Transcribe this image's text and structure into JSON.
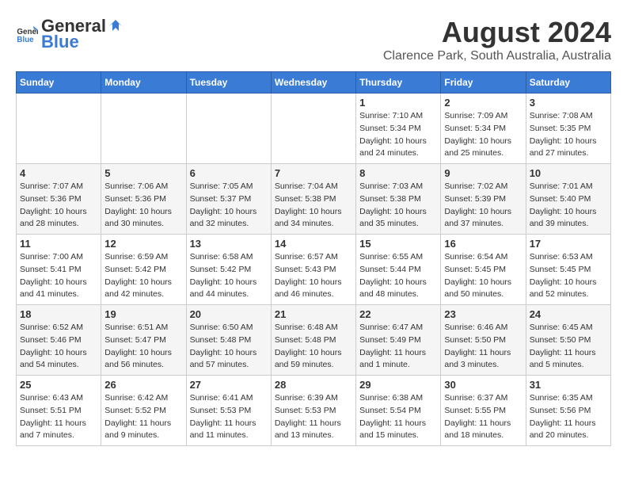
{
  "header": {
    "logo_general": "General",
    "logo_blue": "Blue",
    "main_title": "August 2024",
    "subtitle": "Clarence Park, South Australia, Australia"
  },
  "calendar": {
    "days_of_week": [
      "Sunday",
      "Monday",
      "Tuesday",
      "Wednesday",
      "Thursday",
      "Friday",
      "Saturday"
    ],
    "weeks": [
      [
        {
          "day": "",
          "info": ""
        },
        {
          "day": "",
          "info": ""
        },
        {
          "day": "",
          "info": ""
        },
        {
          "day": "",
          "info": ""
        },
        {
          "day": "1",
          "info": "Sunrise: 7:10 AM\nSunset: 5:34 PM\nDaylight: 10 hours\nand 24 minutes."
        },
        {
          "day": "2",
          "info": "Sunrise: 7:09 AM\nSunset: 5:34 PM\nDaylight: 10 hours\nand 25 minutes."
        },
        {
          "day": "3",
          "info": "Sunrise: 7:08 AM\nSunset: 5:35 PM\nDaylight: 10 hours\nand 27 minutes."
        }
      ],
      [
        {
          "day": "4",
          "info": "Sunrise: 7:07 AM\nSunset: 5:36 PM\nDaylight: 10 hours\nand 28 minutes."
        },
        {
          "day": "5",
          "info": "Sunrise: 7:06 AM\nSunset: 5:36 PM\nDaylight: 10 hours\nand 30 minutes."
        },
        {
          "day": "6",
          "info": "Sunrise: 7:05 AM\nSunset: 5:37 PM\nDaylight: 10 hours\nand 32 minutes."
        },
        {
          "day": "7",
          "info": "Sunrise: 7:04 AM\nSunset: 5:38 PM\nDaylight: 10 hours\nand 34 minutes."
        },
        {
          "day": "8",
          "info": "Sunrise: 7:03 AM\nSunset: 5:38 PM\nDaylight: 10 hours\nand 35 minutes."
        },
        {
          "day": "9",
          "info": "Sunrise: 7:02 AM\nSunset: 5:39 PM\nDaylight: 10 hours\nand 37 minutes."
        },
        {
          "day": "10",
          "info": "Sunrise: 7:01 AM\nSunset: 5:40 PM\nDaylight: 10 hours\nand 39 minutes."
        }
      ],
      [
        {
          "day": "11",
          "info": "Sunrise: 7:00 AM\nSunset: 5:41 PM\nDaylight: 10 hours\nand 41 minutes."
        },
        {
          "day": "12",
          "info": "Sunrise: 6:59 AM\nSunset: 5:42 PM\nDaylight: 10 hours\nand 42 minutes."
        },
        {
          "day": "13",
          "info": "Sunrise: 6:58 AM\nSunset: 5:42 PM\nDaylight: 10 hours\nand 44 minutes."
        },
        {
          "day": "14",
          "info": "Sunrise: 6:57 AM\nSunset: 5:43 PM\nDaylight: 10 hours\nand 46 minutes."
        },
        {
          "day": "15",
          "info": "Sunrise: 6:55 AM\nSunset: 5:44 PM\nDaylight: 10 hours\nand 48 minutes."
        },
        {
          "day": "16",
          "info": "Sunrise: 6:54 AM\nSunset: 5:45 PM\nDaylight: 10 hours\nand 50 minutes."
        },
        {
          "day": "17",
          "info": "Sunrise: 6:53 AM\nSunset: 5:45 PM\nDaylight: 10 hours\nand 52 minutes."
        }
      ],
      [
        {
          "day": "18",
          "info": "Sunrise: 6:52 AM\nSunset: 5:46 PM\nDaylight: 10 hours\nand 54 minutes."
        },
        {
          "day": "19",
          "info": "Sunrise: 6:51 AM\nSunset: 5:47 PM\nDaylight: 10 hours\nand 56 minutes."
        },
        {
          "day": "20",
          "info": "Sunrise: 6:50 AM\nSunset: 5:48 PM\nDaylight: 10 hours\nand 57 minutes."
        },
        {
          "day": "21",
          "info": "Sunrise: 6:48 AM\nSunset: 5:48 PM\nDaylight: 10 hours\nand 59 minutes."
        },
        {
          "day": "22",
          "info": "Sunrise: 6:47 AM\nSunset: 5:49 PM\nDaylight: 11 hours\nand 1 minute."
        },
        {
          "day": "23",
          "info": "Sunrise: 6:46 AM\nSunset: 5:50 PM\nDaylight: 11 hours\nand 3 minutes."
        },
        {
          "day": "24",
          "info": "Sunrise: 6:45 AM\nSunset: 5:50 PM\nDaylight: 11 hours\nand 5 minutes."
        }
      ],
      [
        {
          "day": "25",
          "info": "Sunrise: 6:43 AM\nSunset: 5:51 PM\nDaylight: 11 hours\nand 7 minutes."
        },
        {
          "day": "26",
          "info": "Sunrise: 6:42 AM\nSunset: 5:52 PM\nDaylight: 11 hours\nand 9 minutes."
        },
        {
          "day": "27",
          "info": "Sunrise: 6:41 AM\nSunset: 5:53 PM\nDaylight: 11 hours\nand 11 minutes."
        },
        {
          "day": "28",
          "info": "Sunrise: 6:39 AM\nSunset: 5:53 PM\nDaylight: 11 hours\nand 13 minutes."
        },
        {
          "day": "29",
          "info": "Sunrise: 6:38 AM\nSunset: 5:54 PM\nDaylight: 11 hours\nand 15 minutes."
        },
        {
          "day": "30",
          "info": "Sunrise: 6:37 AM\nSunset: 5:55 PM\nDaylight: 11 hours\nand 18 minutes."
        },
        {
          "day": "31",
          "info": "Sunrise: 6:35 AM\nSunset: 5:56 PM\nDaylight: 11 hours\nand 20 minutes."
        }
      ]
    ]
  }
}
